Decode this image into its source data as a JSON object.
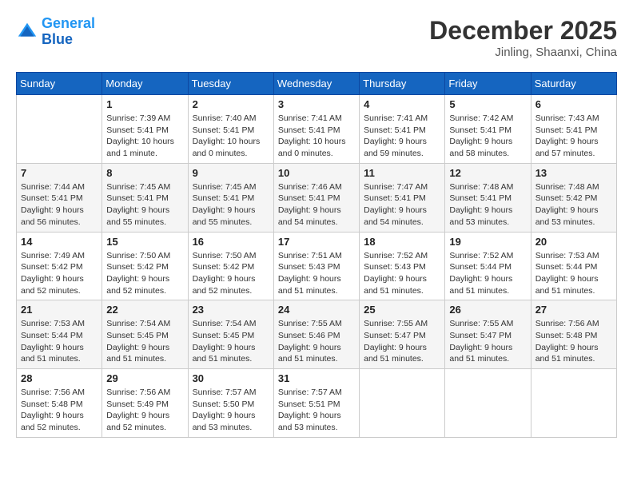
{
  "header": {
    "logo_line1": "General",
    "logo_line2": "Blue",
    "month_title": "December 2025",
    "location": "Jinling, Shaanxi, China"
  },
  "days_of_week": [
    "Sunday",
    "Monday",
    "Tuesday",
    "Wednesday",
    "Thursday",
    "Friday",
    "Saturday"
  ],
  "weeks": [
    [
      {
        "day": "",
        "details": []
      },
      {
        "day": "1",
        "details": [
          "Sunrise: 7:39 AM",
          "Sunset: 5:41 PM",
          "Daylight: 10 hours",
          "and 1 minute."
        ]
      },
      {
        "day": "2",
        "details": [
          "Sunrise: 7:40 AM",
          "Sunset: 5:41 PM",
          "Daylight: 10 hours",
          "and 0 minutes."
        ]
      },
      {
        "day": "3",
        "details": [
          "Sunrise: 7:41 AM",
          "Sunset: 5:41 PM",
          "Daylight: 10 hours",
          "and 0 minutes."
        ]
      },
      {
        "day": "4",
        "details": [
          "Sunrise: 7:41 AM",
          "Sunset: 5:41 PM",
          "Daylight: 9 hours",
          "and 59 minutes."
        ]
      },
      {
        "day": "5",
        "details": [
          "Sunrise: 7:42 AM",
          "Sunset: 5:41 PM",
          "Daylight: 9 hours",
          "and 58 minutes."
        ]
      },
      {
        "day": "6",
        "details": [
          "Sunrise: 7:43 AM",
          "Sunset: 5:41 PM",
          "Daylight: 9 hours",
          "and 57 minutes."
        ]
      }
    ],
    [
      {
        "day": "7",
        "details": [
          "Sunrise: 7:44 AM",
          "Sunset: 5:41 PM",
          "Daylight: 9 hours",
          "and 56 minutes."
        ]
      },
      {
        "day": "8",
        "details": [
          "Sunrise: 7:45 AM",
          "Sunset: 5:41 PM",
          "Daylight: 9 hours",
          "and 55 minutes."
        ]
      },
      {
        "day": "9",
        "details": [
          "Sunrise: 7:45 AM",
          "Sunset: 5:41 PM",
          "Daylight: 9 hours",
          "and 55 minutes."
        ]
      },
      {
        "day": "10",
        "details": [
          "Sunrise: 7:46 AM",
          "Sunset: 5:41 PM",
          "Daylight: 9 hours",
          "and 54 minutes."
        ]
      },
      {
        "day": "11",
        "details": [
          "Sunrise: 7:47 AM",
          "Sunset: 5:41 PM",
          "Daylight: 9 hours",
          "and 54 minutes."
        ]
      },
      {
        "day": "12",
        "details": [
          "Sunrise: 7:48 AM",
          "Sunset: 5:41 PM",
          "Daylight: 9 hours",
          "and 53 minutes."
        ]
      },
      {
        "day": "13",
        "details": [
          "Sunrise: 7:48 AM",
          "Sunset: 5:42 PM",
          "Daylight: 9 hours",
          "and 53 minutes."
        ]
      }
    ],
    [
      {
        "day": "14",
        "details": [
          "Sunrise: 7:49 AM",
          "Sunset: 5:42 PM",
          "Daylight: 9 hours",
          "and 52 minutes."
        ]
      },
      {
        "day": "15",
        "details": [
          "Sunrise: 7:50 AM",
          "Sunset: 5:42 PM",
          "Daylight: 9 hours",
          "and 52 minutes."
        ]
      },
      {
        "day": "16",
        "details": [
          "Sunrise: 7:50 AM",
          "Sunset: 5:42 PM",
          "Daylight: 9 hours",
          "and 52 minutes."
        ]
      },
      {
        "day": "17",
        "details": [
          "Sunrise: 7:51 AM",
          "Sunset: 5:43 PM",
          "Daylight: 9 hours",
          "and 51 minutes."
        ]
      },
      {
        "day": "18",
        "details": [
          "Sunrise: 7:52 AM",
          "Sunset: 5:43 PM",
          "Daylight: 9 hours",
          "and 51 minutes."
        ]
      },
      {
        "day": "19",
        "details": [
          "Sunrise: 7:52 AM",
          "Sunset: 5:44 PM",
          "Daylight: 9 hours",
          "and 51 minutes."
        ]
      },
      {
        "day": "20",
        "details": [
          "Sunrise: 7:53 AM",
          "Sunset: 5:44 PM",
          "Daylight: 9 hours",
          "and 51 minutes."
        ]
      }
    ],
    [
      {
        "day": "21",
        "details": [
          "Sunrise: 7:53 AM",
          "Sunset: 5:44 PM",
          "Daylight: 9 hours",
          "and 51 minutes."
        ]
      },
      {
        "day": "22",
        "details": [
          "Sunrise: 7:54 AM",
          "Sunset: 5:45 PM",
          "Daylight: 9 hours",
          "and 51 minutes."
        ]
      },
      {
        "day": "23",
        "details": [
          "Sunrise: 7:54 AM",
          "Sunset: 5:45 PM",
          "Daylight: 9 hours",
          "and 51 minutes."
        ]
      },
      {
        "day": "24",
        "details": [
          "Sunrise: 7:55 AM",
          "Sunset: 5:46 PM",
          "Daylight: 9 hours",
          "and 51 minutes."
        ]
      },
      {
        "day": "25",
        "details": [
          "Sunrise: 7:55 AM",
          "Sunset: 5:47 PM",
          "Daylight: 9 hours",
          "and 51 minutes."
        ]
      },
      {
        "day": "26",
        "details": [
          "Sunrise: 7:55 AM",
          "Sunset: 5:47 PM",
          "Daylight: 9 hours",
          "and 51 minutes."
        ]
      },
      {
        "day": "27",
        "details": [
          "Sunrise: 7:56 AM",
          "Sunset: 5:48 PM",
          "Daylight: 9 hours",
          "and 51 minutes."
        ]
      }
    ],
    [
      {
        "day": "28",
        "details": [
          "Sunrise: 7:56 AM",
          "Sunset: 5:48 PM",
          "Daylight: 9 hours",
          "and 52 minutes."
        ]
      },
      {
        "day": "29",
        "details": [
          "Sunrise: 7:56 AM",
          "Sunset: 5:49 PM",
          "Daylight: 9 hours",
          "and 52 minutes."
        ]
      },
      {
        "day": "30",
        "details": [
          "Sunrise: 7:57 AM",
          "Sunset: 5:50 PM",
          "Daylight: 9 hours",
          "and 53 minutes."
        ]
      },
      {
        "day": "31",
        "details": [
          "Sunrise: 7:57 AM",
          "Sunset: 5:51 PM",
          "Daylight: 9 hours",
          "and 53 minutes."
        ]
      },
      {
        "day": "",
        "details": []
      },
      {
        "day": "",
        "details": []
      },
      {
        "day": "",
        "details": []
      }
    ]
  ]
}
